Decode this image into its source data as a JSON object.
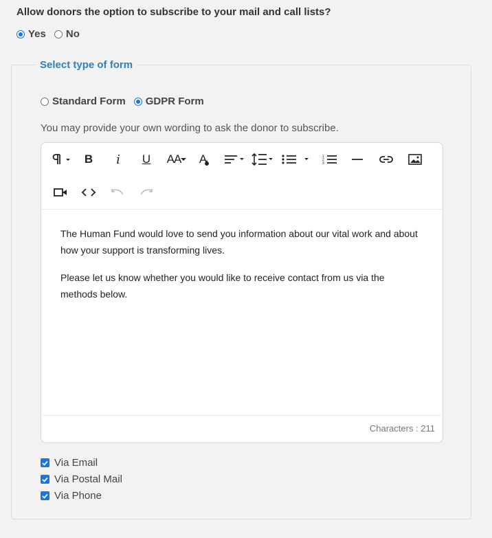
{
  "subscribe": {
    "question": "Allow donors the option to subscribe to your mail and call lists?",
    "options": [
      {
        "label": "Yes",
        "checked": true
      },
      {
        "label": "No",
        "checked": false
      }
    ]
  },
  "form_type": {
    "legend": "Select type of form",
    "options": [
      {
        "label": "Standard Form",
        "checked": false
      },
      {
        "label": "GDPR Form",
        "checked": true
      }
    ]
  },
  "editor": {
    "hint": "You may provide your own wording to ask the donor to subscribe.",
    "toolbar": {
      "paragraph": "paragraph-icon",
      "bold": "B",
      "italic": "i",
      "underline": "U",
      "font_size": "AA",
      "font_color": "A",
      "align": "align-icon",
      "line_height": "line-height-icon",
      "bullet_list": "bullet-list-icon",
      "numbered_list": "numbered-list-icon",
      "hr": "horizontal-rule-icon",
      "link": "link-icon",
      "image": "image-icon",
      "video": "video-icon",
      "code": "<>",
      "undo": "undo-icon",
      "redo": "redo-icon"
    },
    "paragraphs": [
      "The Human Fund would love to send you information about our vital work and about how your support is transforming lives.",
      "Please let us know whether you would like to receive contact from us via the methods below."
    ],
    "counter": "Characters : 211"
  },
  "contact_methods": [
    {
      "label": "Via Email",
      "checked": true
    },
    {
      "label": "Via Postal Mail",
      "checked": true
    },
    {
      "label": "Via Phone",
      "checked": true
    }
  ],
  "colors": {
    "accent": "#1a73e8",
    "legend": "#2f7fc1"
  }
}
